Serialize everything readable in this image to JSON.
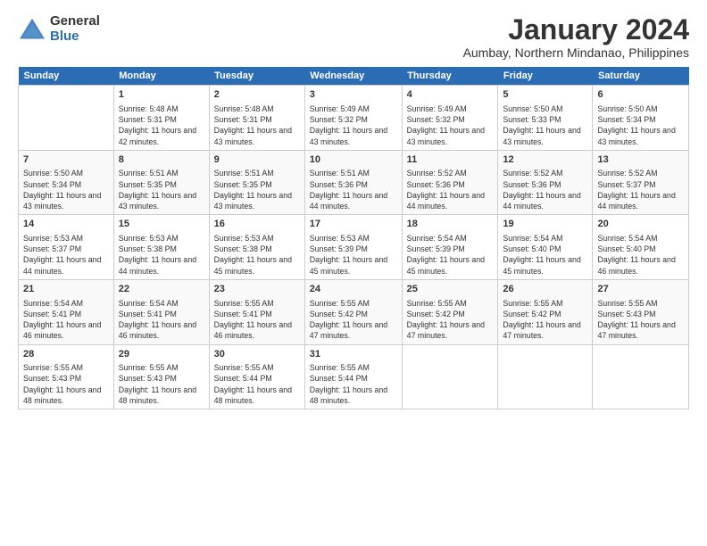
{
  "header": {
    "logo_general": "General",
    "logo_blue": "Blue",
    "month_title": "January 2024",
    "location": "Aumbay, Northern Mindanao, Philippines"
  },
  "calendar": {
    "days_of_week": [
      "Sunday",
      "Monday",
      "Tuesday",
      "Wednesday",
      "Thursday",
      "Friday",
      "Saturday"
    ],
    "weeks": [
      [
        {
          "day": "",
          "sunrise": "",
          "sunset": "",
          "daylight": ""
        },
        {
          "day": "1",
          "sunrise": "Sunrise: 5:48 AM",
          "sunset": "Sunset: 5:31 PM",
          "daylight": "Daylight: 11 hours and 42 minutes."
        },
        {
          "day": "2",
          "sunrise": "Sunrise: 5:48 AM",
          "sunset": "Sunset: 5:31 PM",
          "daylight": "Daylight: 11 hours and 43 minutes."
        },
        {
          "day": "3",
          "sunrise": "Sunrise: 5:49 AM",
          "sunset": "Sunset: 5:32 PM",
          "daylight": "Daylight: 11 hours and 43 minutes."
        },
        {
          "day": "4",
          "sunrise": "Sunrise: 5:49 AM",
          "sunset": "Sunset: 5:32 PM",
          "daylight": "Daylight: 11 hours and 43 minutes."
        },
        {
          "day": "5",
          "sunrise": "Sunrise: 5:50 AM",
          "sunset": "Sunset: 5:33 PM",
          "daylight": "Daylight: 11 hours and 43 minutes."
        },
        {
          "day": "6",
          "sunrise": "Sunrise: 5:50 AM",
          "sunset": "Sunset: 5:34 PM",
          "daylight": "Daylight: 11 hours and 43 minutes."
        }
      ],
      [
        {
          "day": "7",
          "sunrise": "Sunrise: 5:50 AM",
          "sunset": "Sunset: 5:34 PM",
          "daylight": "Daylight: 11 hours and 43 minutes."
        },
        {
          "day": "8",
          "sunrise": "Sunrise: 5:51 AM",
          "sunset": "Sunset: 5:35 PM",
          "daylight": "Daylight: 11 hours and 43 minutes."
        },
        {
          "day": "9",
          "sunrise": "Sunrise: 5:51 AM",
          "sunset": "Sunset: 5:35 PM",
          "daylight": "Daylight: 11 hours and 43 minutes."
        },
        {
          "day": "10",
          "sunrise": "Sunrise: 5:51 AM",
          "sunset": "Sunset: 5:36 PM",
          "daylight": "Daylight: 11 hours and 44 minutes."
        },
        {
          "day": "11",
          "sunrise": "Sunrise: 5:52 AM",
          "sunset": "Sunset: 5:36 PM",
          "daylight": "Daylight: 11 hours and 44 minutes."
        },
        {
          "day": "12",
          "sunrise": "Sunrise: 5:52 AM",
          "sunset": "Sunset: 5:36 PM",
          "daylight": "Daylight: 11 hours and 44 minutes."
        },
        {
          "day": "13",
          "sunrise": "Sunrise: 5:52 AM",
          "sunset": "Sunset: 5:37 PM",
          "daylight": "Daylight: 11 hours and 44 minutes."
        }
      ],
      [
        {
          "day": "14",
          "sunrise": "Sunrise: 5:53 AM",
          "sunset": "Sunset: 5:37 PM",
          "daylight": "Daylight: 11 hours and 44 minutes."
        },
        {
          "day": "15",
          "sunrise": "Sunrise: 5:53 AM",
          "sunset": "Sunset: 5:38 PM",
          "daylight": "Daylight: 11 hours and 44 minutes."
        },
        {
          "day": "16",
          "sunrise": "Sunrise: 5:53 AM",
          "sunset": "Sunset: 5:38 PM",
          "daylight": "Daylight: 11 hours and 45 minutes."
        },
        {
          "day": "17",
          "sunrise": "Sunrise: 5:53 AM",
          "sunset": "Sunset: 5:39 PM",
          "daylight": "Daylight: 11 hours and 45 minutes."
        },
        {
          "day": "18",
          "sunrise": "Sunrise: 5:54 AM",
          "sunset": "Sunset: 5:39 PM",
          "daylight": "Daylight: 11 hours and 45 minutes."
        },
        {
          "day": "19",
          "sunrise": "Sunrise: 5:54 AM",
          "sunset": "Sunset: 5:40 PM",
          "daylight": "Daylight: 11 hours and 45 minutes."
        },
        {
          "day": "20",
          "sunrise": "Sunrise: 5:54 AM",
          "sunset": "Sunset: 5:40 PM",
          "daylight": "Daylight: 11 hours and 46 minutes."
        }
      ],
      [
        {
          "day": "21",
          "sunrise": "Sunrise: 5:54 AM",
          "sunset": "Sunset: 5:41 PM",
          "daylight": "Daylight: 11 hours and 46 minutes."
        },
        {
          "day": "22",
          "sunrise": "Sunrise: 5:54 AM",
          "sunset": "Sunset: 5:41 PM",
          "daylight": "Daylight: 11 hours and 46 minutes."
        },
        {
          "day": "23",
          "sunrise": "Sunrise: 5:55 AM",
          "sunset": "Sunset: 5:41 PM",
          "daylight": "Daylight: 11 hours and 46 minutes."
        },
        {
          "day": "24",
          "sunrise": "Sunrise: 5:55 AM",
          "sunset": "Sunset: 5:42 PM",
          "daylight": "Daylight: 11 hours and 47 minutes."
        },
        {
          "day": "25",
          "sunrise": "Sunrise: 5:55 AM",
          "sunset": "Sunset: 5:42 PM",
          "daylight": "Daylight: 11 hours and 47 minutes."
        },
        {
          "day": "26",
          "sunrise": "Sunrise: 5:55 AM",
          "sunset": "Sunset: 5:42 PM",
          "daylight": "Daylight: 11 hours and 47 minutes."
        },
        {
          "day": "27",
          "sunrise": "Sunrise: 5:55 AM",
          "sunset": "Sunset: 5:43 PM",
          "daylight": "Daylight: 11 hours and 47 minutes."
        }
      ],
      [
        {
          "day": "28",
          "sunrise": "Sunrise: 5:55 AM",
          "sunset": "Sunset: 5:43 PM",
          "daylight": "Daylight: 11 hours and 48 minutes."
        },
        {
          "day": "29",
          "sunrise": "Sunrise: 5:55 AM",
          "sunset": "Sunset: 5:43 PM",
          "daylight": "Daylight: 11 hours and 48 minutes."
        },
        {
          "day": "30",
          "sunrise": "Sunrise: 5:55 AM",
          "sunset": "Sunset: 5:44 PM",
          "daylight": "Daylight: 11 hours and 48 minutes."
        },
        {
          "day": "31",
          "sunrise": "Sunrise: 5:55 AM",
          "sunset": "Sunset: 5:44 PM",
          "daylight": "Daylight: 11 hours and 48 minutes."
        },
        {
          "day": "",
          "sunrise": "",
          "sunset": "",
          "daylight": ""
        },
        {
          "day": "",
          "sunrise": "",
          "sunset": "",
          "daylight": ""
        },
        {
          "day": "",
          "sunrise": "",
          "sunset": "",
          "daylight": ""
        }
      ]
    ]
  }
}
